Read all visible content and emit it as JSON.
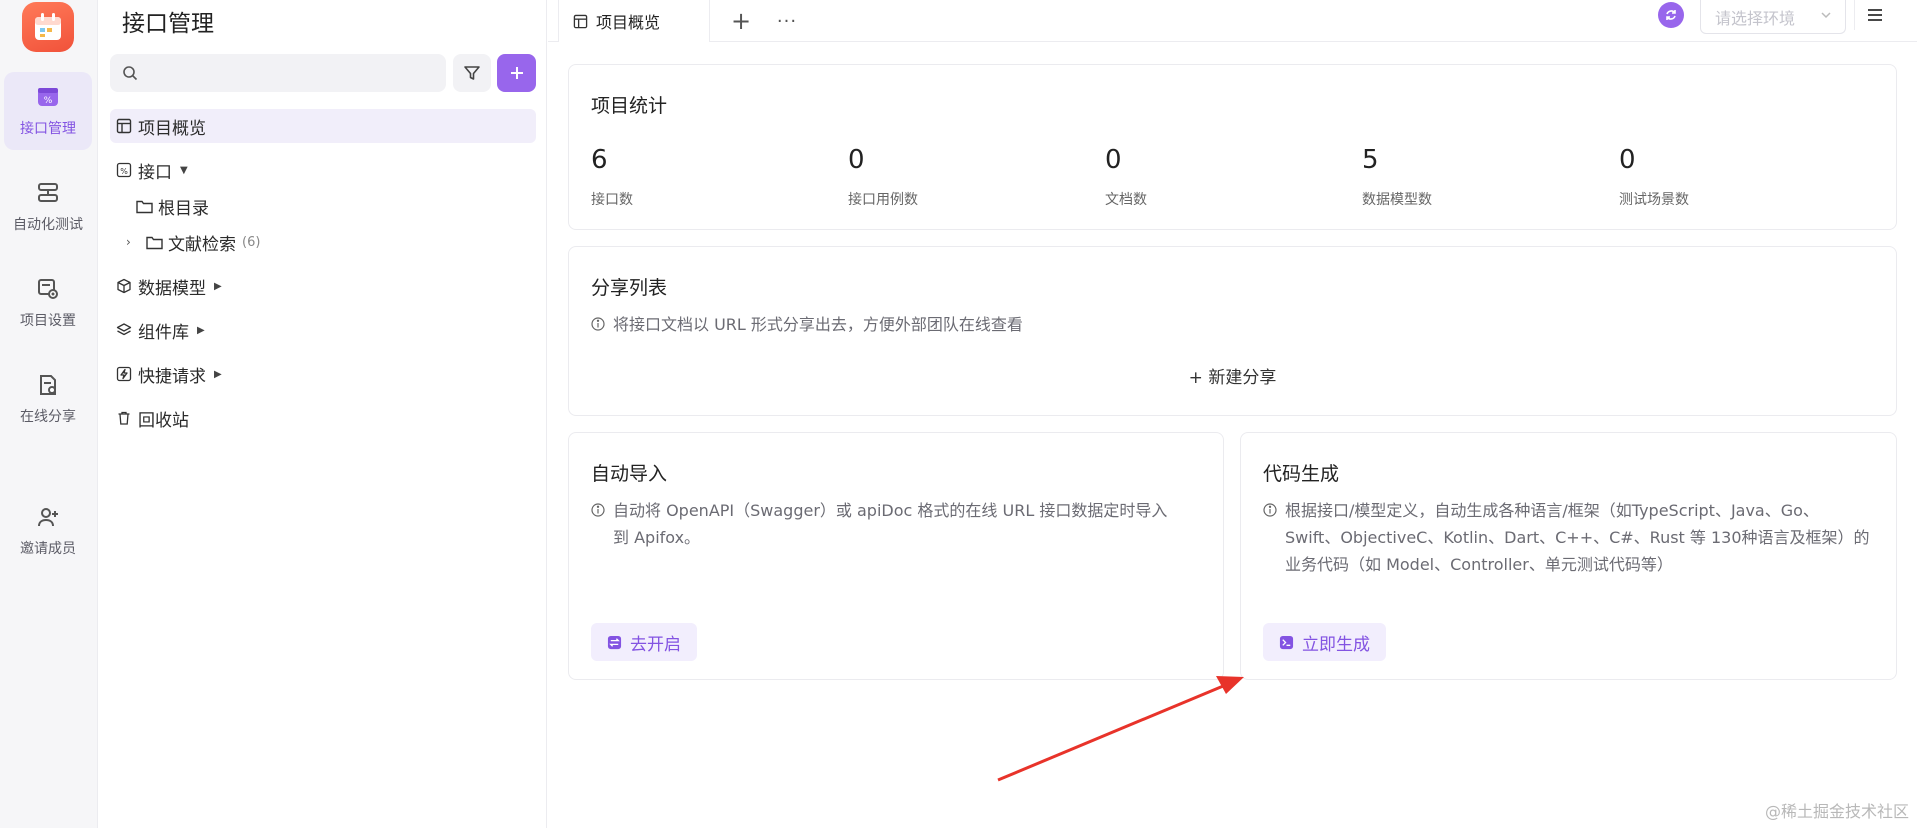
{
  "rail": {
    "items": [
      {
        "label": "接口管理",
        "icon": "api-icon",
        "active": true
      },
      {
        "label": "自动化测试",
        "icon": "automation-icon",
        "active": false
      },
      {
        "label": "项目设置",
        "icon": "project-settings-icon",
        "active": false
      },
      {
        "label": "在线分享",
        "icon": "online-share-icon",
        "active": false
      },
      {
        "label": "邀请成员",
        "icon": "invite-member-icon",
        "active": false
      }
    ]
  },
  "tree": {
    "title": "接口管理",
    "search_placeholder": "",
    "rows": [
      {
        "label": "项目概览",
        "icon": "layout-icon"
      },
      {
        "label": "接口",
        "icon": "api-percent-icon"
      },
      {
        "label": "根目录",
        "icon": "folder-icon"
      },
      {
        "label": "文献检索",
        "icon": "folder-icon",
        "count": "(6)"
      },
      {
        "label": "数据模型",
        "icon": "cube-icon"
      },
      {
        "label": "组件库",
        "icon": "layers-icon"
      },
      {
        "label": "快捷请求",
        "icon": "lightning-icon"
      },
      {
        "label": "回收站",
        "icon": "trash-icon"
      }
    ]
  },
  "tabs": {
    "active_label": "项目概览",
    "add_label": "+",
    "more_label": "···",
    "env_placeholder": "请选择环境"
  },
  "stats": {
    "title": "项目统计",
    "items": [
      {
        "value": "6",
        "label": "接口数"
      },
      {
        "value": "0",
        "label": "接口用例数"
      },
      {
        "value": "0",
        "label": "文档数"
      },
      {
        "value": "5",
        "label": "数据模型数"
      },
      {
        "value": "0",
        "label": "测试场景数"
      }
    ]
  },
  "share": {
    "title": "分享列表",
    "description": "将接口文档以 URL 形式分享出去，方便外部团队在线查看",
    "new_label": "+ 新建分享"
  },
  "auto_import": {
    "title": "自动导入",
    "description_line1": "自动将 OpenAPI（Swagger）或 apiDoc 格式的在线 URL 接口数据定时导入",
    "description_line2": "到 Apifox。",
    "button_label": "去开启"
  },
  "codegen": {
    "title": "代码生成",
    "description_line1": "根据接口/模型定义，自动生成各种语言/框架（如TypeScript、Java、Go、",
    "description_line2": "Swift、ObjectiveC、Kotlin、Dart、C++、C#、Rust 等 130种语言及框架）的",
    "description_line3": "业务代码（如 Model、Controller、单元测试代码等）",
    "button_label": "立即生成"
  },
  "watermark": "@稀土掘金技术社区",
  "colors": {
    "accent": "#9866ec",
    "accent_text": "#8353e2",
    "annotation_arrow": "#e8332a"
  }
}
